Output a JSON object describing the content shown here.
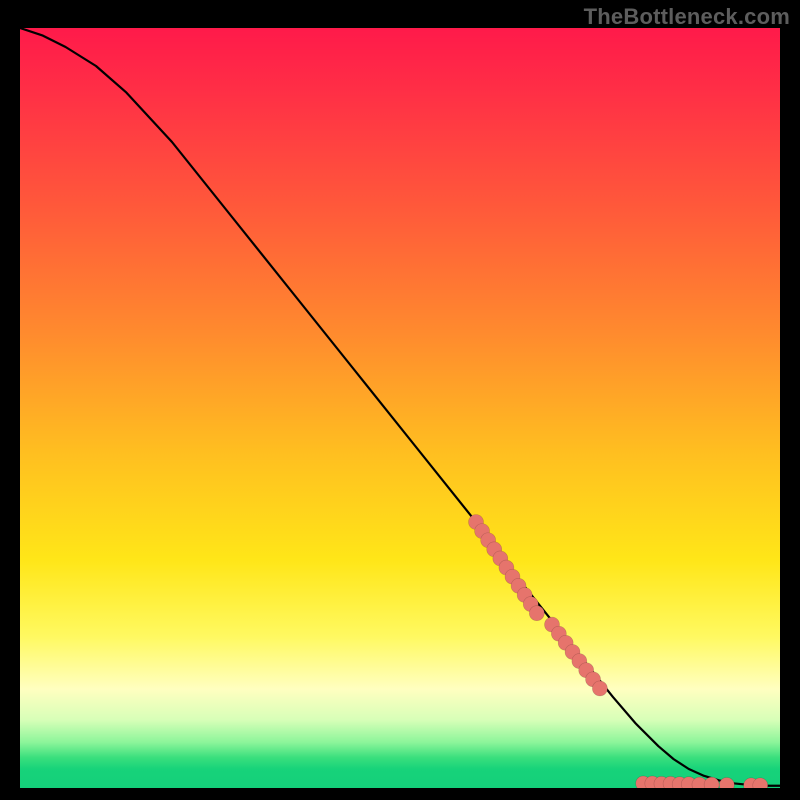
{
  "watermark": "TheBottleneck.com",
  "chart_data": {
    "type": "line",
    "title": "",
    "xlabel": "",
    "ylabel": "",
    "xlim": [
      0,
      100
    ],
    "ylim": [
      0,
      100
    ],
    "grid": false,
    "legend": false,
    "series": [
      {
        "name": "curve",
        "x": [
          0,
          3,
          6,
          10,
          14,
          20,
          28,
          36,
          44,
          52,
          60,
          66,
          70,
          74,
          78,
          81,
          84,
          86,
          88,
          90,
          92,
          94,
          96,
          98,
          100
        ],
        "y": [
          100,
          99,
          97.5,
          95,
          91.5,
          85,
          75,
          65,
          55,
          45,
          35,
          27,
          22,
          17,
          12,
          8.5,
          5.5,
          3.8,
          2.5,
          1.6,
          1.0,
          0.6,
          0.4,
          0.3,
          0.3
        ]
      }
    ],
    "points": [
      {
        "name": "upper-cluster",
        "coords": [
          {
            "x": 60.0,
            "y": 35.0
          },
          {
            "x": 60.8,
            "y": 33.8
          },
          {
            "x": 61.6,
            "y": 32.6
          },
          {
            "x": 62.4,
            "y": 31.4
          },
          {
            "x": 63.2,
            "y": 30.2
          },
          {
            "x": 64.0,
            "y": 29.0
          },
          {
            "x": 64.8,
            "y": 27.8
          },
          {
            "x": 65.6,
            "y": 26.6
          },
          {
            "x": 66.4,
            "y": 25.4
          },
          {
            "x": 67.2,
            "y": 24.2
          },
          {
            "x": 68.0,
            "y": 23.0
          }
        ]
      },
      {
        "name": "mid-cluster",
        "coords": [
          {
            "x": 70.0,
            "y": 21.5
          },
          {
            "x": 70.9,
            "y": 20.3
          },
          {
            "x": 71.8,
            "y": 19.1
          },
          {
            "x": 72.7,
            "y": 17.9
          },
          {
            "x": 73.6,
            "y": 16.7
          },
          {
            "x": 74.5,
            "y": 15.5
          },
          {
            "x": 75.4,
            "y": 14.3
          },
          {
            "x": 76.3,
            "y": 13.1
          }
        ]
      },
      {
        "name": "bottom-run",
        "coords": [
          {
            "x": 82.0,
            "y": 0.6
          },
          {
            "x": 83.2,
            "y": 0.6
          },
          {
            "x": 84.4,
            "y": 0.55
          },
          {
            "x": 85.6,
            "y": 0.55
          },
          {
            "x": 86.8,
            "y": 0.5
          },
          {
            "x": 88.0,
            "y": 0.5
          },
          {
            "x": 89.4,
            "y": 0.45
          },
          {
            "x": 91.0,
            "y": 0.45
          },
          {
            "x": 93.0,
            "y": 0.4
          },
          {
            "x": 96.2,
            "y": 0.35
          },
          {
            "x": 97.4,
            "y": 0.35
          }
        ]
      }
    ],
    "colors": {
      "curve": "#000000",
      "points": "#e6746c",
      "gradient_top": "#ff1a4a",
      "gradient_mid": "#ffe618",
      "gradient_bottom": "#14cf7a"
    }
  }
}
